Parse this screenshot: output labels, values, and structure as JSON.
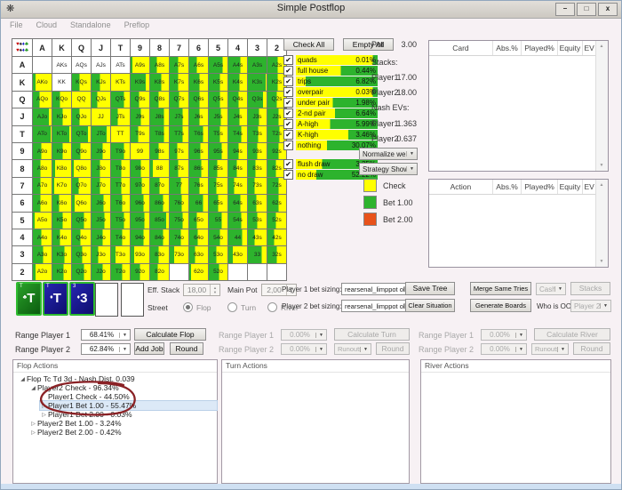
{
  "window": {
    "title": "Simple Postflop",
    "btn_min": "–",
    "btn_max": "□",
    "btn_close": "x"
  },
  "menu": [
    "File",
    "Cloud",
    "Standalone",
    "Preflop"
  ],
  "colors": {
    "check_yellow": "#ffff00",
    "bet1_green": "#2db32d",
    "bet2_orange": "#e8521a",
    "card_club_bg": [
      "#2aa02a",
      "#0b5c0e"
    ],
    "card_diamond_bg": [
      "#2626b0",
      "#0e0e6e"
    ],
    "card_border": "#2fbb2f",
    "annotation": "#8a2125"
  },
  "matrix": {
    "ranks": [
      "A",
      "K",
      "Q",
      "J",
      "T",
      "9",
      "8",
      "7",
      "6",
      "5",
      "4",
      "3",
      "2"
    ],
    "corner_suits": [
      {
        "glyph": "♥",
        "color": "#c40000"
      },
      {
        "glyph": "♠",
        "color": "#222222"
      },
      {
        "glyph": "♦",
        "color": "#2222cc"
      },
      {
        "glyph": "♣",
        "color": "#149114"
      }
    ],
    "labels": [
      [
        "",
        "AKs",
        "AQs",
        "AJs",
        "ATs",
        "A9s",
        "A8s",
        "A7s",
        "A6s",
        "A5s",
        "A4s",
        "A3s",
        "A2s"
      ],
      [
        "AKo",
        "KK",
        "KQs",
        "KJs",
        "KTs",
        "K9s",
        "K8s",
        "K7s",
        "K6s",
        "K5s",
        "K4s",
        "K3s",
        "K2s"
      ],
      [
        "AQo",
        "KQo",
        "QQ",
        "QJs",
        "QTs",
        "Q9s",
        "Q8s",
        "Q7s",
        "Q6s",
        "Q5s",
        "Q4s",
        "Q3s",
        "Q2s"
      ],
      [
        "AJo",
        "KJo",
        "QJo",
        "JJ",
        "JTs",
        "J9s",
        "J8s",
        "J7s",
        "J6s",
        "J5s",
        "J4s",
        "J3s",
        "J2s"
      ],
      [
        "ATo",
        "KTo",
        "QTo",
        "JTo",
        "TT",
        "T9s",
        "T8s",
        "T7s",
        "T6s",
        "T5s",
        "T4s",
        "T3s",
        "T2s"
      ],
      [
        "A9o",
        "K9o",
        "Q9o",
        "J9o",
        "T9o",
        "99",
        "98s",
        "97s",
        "96s",
        "95s",
        "94s",
        "93s",
        "92s"
      ],
      [
        "A8o",
        "K8o",
        "Q8o",
        "J8o",
        "T8o",
        "98o",
        "88",
        "87s",
        "86s",
        "85s",
        "84s",
        "83s",
        "82s"
      ],
      [
        "A7o",
        "K7o",
        "Q7o",
        "J7o",
        "T7o",
        "97o",
        "87o",
        "77",
        "76s",
        "75s",
        "74s",
        "73s",
        "72s"
      ],
      [
        "A6o",
        "K6o",
        "Q6o",
        "J6o",
        "T6o",
        "96o",
        "86o",
        "76o",
        "66",
        "65s",
        "64s",
        "63s",
        "62s"
      ],
      [
        "A5o",
        "K5o",
        "Q5o",
        "J5o",
        "T5o",
        "95o",
        "85o",
        "75o",
        "65o",
        "55",
        "54s",
        "53s",
        "52s"
      ],
      [
        "A4o",
        "K4o",
        "Q4o",
        "J4o",
        "T4o",
        "94o",
        "84o",
        "74o",
        "64o",
        "54o",
        "44",
        "43s",
        "42s"
      ],
      [
        "A3o",
        "K3o",
        "Q3o",
        "J3o",
        "T3o",
        "93o",
        "83o",
        "73o",
        "63o",
        "53o",
        "43o",
        "33",
        "32s"
      ],
      [
        "A2o",
        "K2o",
        "Q2o",
        "J2o",
        "T2o",
        "92o",
        "82o",
        "",
        "62o",
        "52o",
        "",
        "",
        ""
      ]
    ],
    "green_pct": [
      [
        -1,
        -1,
        -1,
        -1,
        -1,
        10,
        35,
        45,
        40,
        75,
        65,
        100,
        55
      ],
      [
        15,
        -1,
        40,
        45,
        0,
        80,
        60,
        45,
        55,
        60,
        60,
        95,
        55
      ],
      [
        35,
        40,
        0,
        30,
        70,
        45,
        45,
        50,
        55,
        60,
        55,
        80,
        50
      ],
      [
        85,
        55,
        40,
        0,
        35,
        55,
        75,
        70,
        55,
        65,
        60,
        60,
        60
      ],
      [
        95,
        90,
        85,
        80,
        0,
        40,
        75,
        70,
        75,
        60,
        70,
        55,
        65
      ],
      [
        45,
        55,
        45,
        60,
        70,
        0,
        45,
        40,
        60,
        70,
        55,
        50,
        60
      ],
      [
        40,
        15,
        10,
        45,
        55,
        55,
        15,
        45,
        65,
        45,
        45,
        40,
        45
      ],
      [
        40,
        10,
        35,
        45,
        55,
        60,
        50,
        60,
        55,
        40,
        30,
        35,
        60
      ],
      [
        40,
        35,
        15,
        65,
        60,
        70,
        70,
        65,
        75,
        50,
        65,
        45,
        60
      ],
      [
        10,
        55,
        65,
        70,
        70,
        75,
        85,
        70,
        40,
        70,
        70,
        50,
        45
      ],
      [
        45,
        40,
        45,
        60,
        60,
        70,
        70,
        60,
        45,
        60,
        75,
        35,
        35
      ],
      [
        55,
        65,
        55,
        35,
        25,
        20,
        45,
        25,
        30,
        40,
        25,
        75,
        50
      ],
      [
        15,
        60,
        65,
        60,
        60,
        50,
        40,
        -1,
        10,
        55,
        -1,
        -1,
        -1
      ]
    ]
  },
  "controls": {
    "check_all": "Check All",
    "empty_all": "Empty All"
  },
  "categories": {
    "group1": [
      {
        "label": "quads",
        "pct": "0.01%",
        "green": 6
      },
      {
        "label": "full house",
        "pct": "0.44%",
        "green": 45
      },
      {
        "label": "trips",
        "pct": "6.82%",
        "green": 88
      },
      {
        "label": "overpair",
        "pct": "0.03%",
        "green": 6
      },
      {
        "label": "under pair",
        "pct": "1.98%",
        "green": 55
      },
      {
        "label": "2-nd pair",
        "pct": "6.64%",
        "green": 52
      },
      {
        "label": "A-high",
        "pct": "5.99%",
        "green": 58
      },
      {
        "label": "K-high",
        "pct": "3.46%",
        "green": 36
      },
      {
        "label": "nothing",
        "pct": "30.07%",
        "green": 62
      }
    ],
    "group2": [
      {
        "label": "flush draw",
        "pct": "3.25%",
        "green": 68
      },
      {
        "label": "no draw",
        "pct": "52.22%",
        "green": 75
      }
    ]
  },
  "info": {
    "pot_label": "Pot",
    "pot_value": "3.00",
    "stacks_label": "Stacks:",
    "player1_label": "Player1",
    "player1_stack": "17.00",
    "player2_label": "Player2",
    "player2_stack": "18.00",
    "nash_label": "Nash EVs:",
    "nash_p1": "1.363",
    "nash_p2": "0.637"
  },
  "combos": {
    "normalize": "Normalize weight",
    "strategy": "Strategy Show"
  },
  "legend": [
    {
      "label": "Check",
      "color": "#ffff00"
    },
    {
      "label": "Bet 1.00",
      "color": "#2db32d"
    },
    {
      "label": "Bet 2.00",
      "color": "#e8521a"
    }
  ],
  "tables": {
    "card_headers": [
      "Card",
      "Abs.%",
      "Played%",
      "Equity",
      "EV"
    ],
    "action_headers": [
      "Action",
      "Abs.%",
      "Played%",
      "Equity",
      "EV"
    ]
  },
  "board": {
    "cards": [
      {
        "rank": "T",
        "suit": "club"
      },
      {
        "rank": "T",
        "suit": "diamond"
      },
      {
        "rank": "3",
        "suit": "diamond"
      }
    ]
  },
  "setup": {
    "eff_stack_label": "Eff. Stack",
    "eff_stack_value": "18,00",
    "main_pot_label": "Main Pot",
    "main_pot_value": "2,00",
    "street_label": "Street",
    "streets": [
      "Flop",
      "Turn",
      "River"
    ],
    "selected_street": "Flop",
    "p1_sizing_label": "Player 1 bet sizing:",
    "p2_sizing_label": "Player 2 bet sizing:",
    "sizing_value": "rearsenal_limppot oka",
    "save_tree": "Save Tree",
    "merge": "Merge Same Tries",
    "clear": "Clear Situation",
    "generate": "Generate Boards",
    "cash": "Cash",
    "stacks_btn": "Stacks",
    "oop_label": "Who is OOP:",
    "oop_value": "Player 2"
  },
  "ranges": {
    "flop": {
      "p1_label": "Range Player 1",
      "p1_value": "68.41%",
      "calc": "Calculate Flop",
      "p2_label": "Range Player 2",
      "p2_value": "62.84%",
      "add_job": "Add Job",
      "round": "Round"
    },
    "turn": {
      "p1_label": "Range Player 1",
      "p1_value": "0.00%",
      "calc": "Calculate Turn",
      "p2_label": "Range Player 2",
      "p2_value": "0.00%",
      "runouts": "Runouts",
      "round": "Round"
    },
    "river": {
      "p1_label": "Range Player 1",
      "p1_value": "0.00%",
      "calc": "Calculate River",
      "p2_label": "Range Player 2",
      "p2_value": "0.00%",
      "runouts": "Runouts",
      "round": "Round"
    }
  },
  "panels": {
    "flop_title": "Flop Actions",
    "turn_title": "Turn Actions",
    "river_title": "River Actions"
  },
  "tree": [
    {
      "indent": 0,
      "arrow": "expanded",
      "text": "Flop Tc Td 3d - Nash Dist. 0.039",
      "selected": false
    },
    {
      "indent": 1,
      "arrow": "expanded",
      "text": "Player2 Check - 96.34%",
      "selected": false
    },
    {
      "indent": 2,
      "arrow": "none",
      "text": "Player1 Check - 44.50%",
      "selected": false
    },
    {
      "indent": 2,
      "arrow": "collapsed",
      "text": "Player1 Bet 1.00 - 55.47%",
      "selected": true
    },
    {
      "indent": 2,
      "arrow": "collapsed",
      "text": "Player1 Bet 2.00 - 0.03%",
      "selected": false
    },
    {
      "indent": 1,
      "arrow": "collapsed",
      "text": "Player2 Bet 1.00 - 3.24%",
      "selected": false
    },
    {
      "indent": 1,
      "arrow": "collapsed",
      "text": "Player2 Bet 2.00 - 0.42%",
      "selected": false
    }
  ]
}
